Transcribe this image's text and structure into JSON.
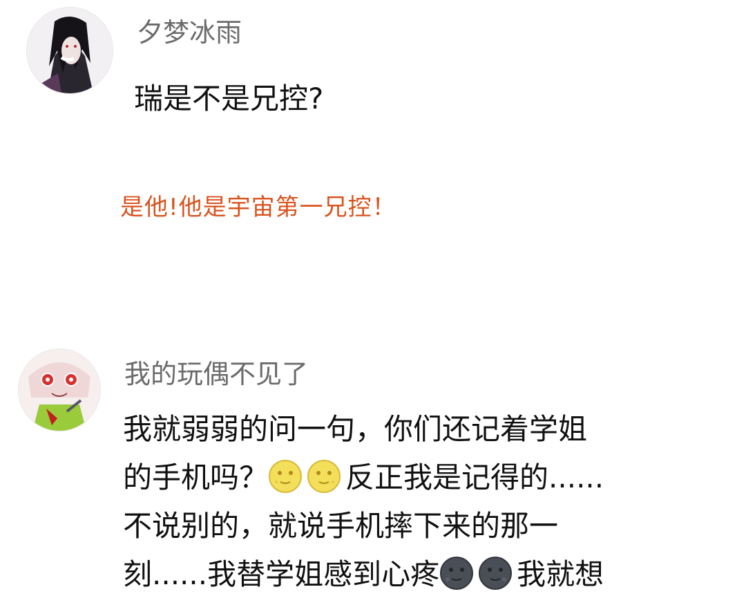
{
  "comments": [
    {
      "username": "夕梦冰雨",
      "lines": [
        "瑞是不是兄控?"
      ],
      "reply": "是他!他是宇宙第一兄控！"
    },
    {
      "username": "我的玩偶不见了",
      "lines": [
        "我就弱弱的问一句，你们还记着学姐",
        "的手机吗？",
        "反正我是记得的......",
        "不说别的，就说手机摔下来的那一",
        "刻......我替学姐感到心疼",
        "我就想"
      ]
    }
  ],
  "emojis": {
    "full_moon_face": "full-moon-face-emoji",
    "new_moon_face": "new-moon-face-emoji"
  },
  "colors": {
    "username": "#6b6b6b",
    "reply": "#d9531e",
    "text": "#111111"
  }
}
